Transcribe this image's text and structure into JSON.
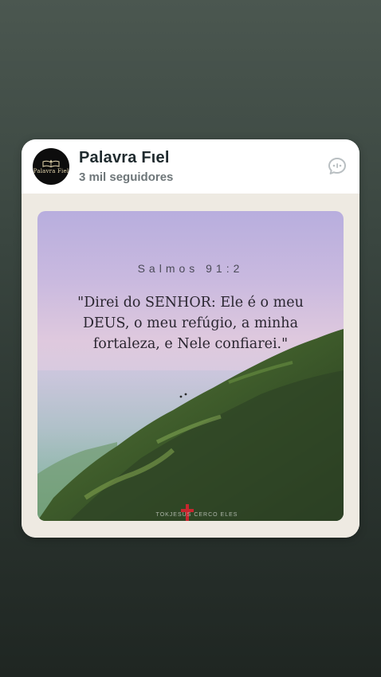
{
  "post": {
    "channel_name": "Palavra Fιel",
    "followers": "3 mil seguidores",
    "avatar_label": "Palavra Fiel",
    "action_icon": "chat-bubble-icon"
  },
  "image": {
    "verse_reference": "Salmos 91:2",
    "verse_text": "\"Direi do SENHOR: Ele é o meu DEUS, o meu refúgio, a minha fortaleza, e Nele confiarei.\"",
    "watermark_text": "TOKJESUS CERCO ELES",
    "description_icon": "mountain-landscape"
  },
  "colors": {
    "background_top": "#4b5750",
    "background_bottom": "#1f2622",
    "card": "#ffffff",
    "card_body": "#eeeae2",
    "title_text": "#1f2a2e",
    "subtitle_text": "#6e7679"
  }
}
